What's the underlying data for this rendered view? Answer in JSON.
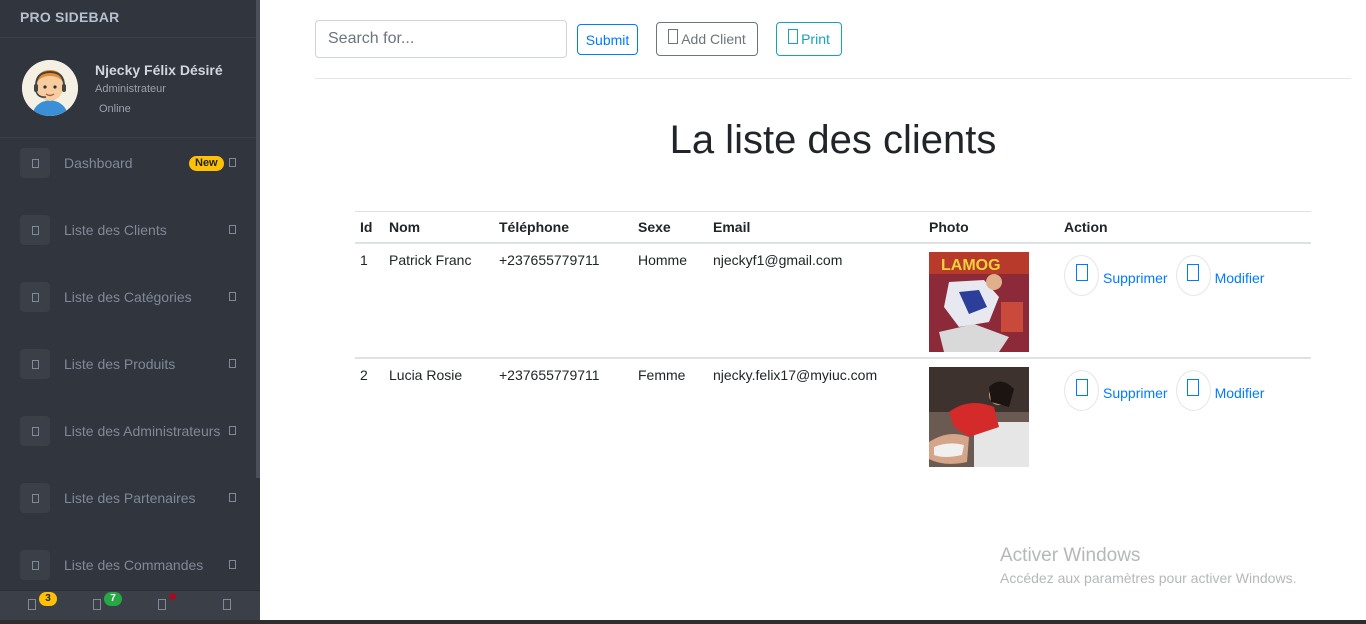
{
  "sidebar": {
    "brand": "PRO SIDEBAR",
    "user": {
      "name": "Njecky Félix Désiré",
      "role": "Administrateur",
      "status": "Online"
    },
    "items": [
      {
        "label": "Dashboard",
        "badge": "New"
      },
      {
        "label": "Liste des Clients"
      },
      {
        "label": "Liste des Catégories"
      },
      {
        "label": "Liste des Produits"
      },
      {
        "label": "Liste des Administrateurs"
      },
      {
        "label": "Liste des Partenaires"
      },
      {
        "label": "Liste des Commandes"
      }
    ],
    "footer": {
      "notifications_count": "3",
      "messages_count": "7"
    }
  },
  "toolbar": {
    "search_placeholder": "Search for...",
    "submit_label": "Submit",
    "add_client_label": "Add Client",
    "print_label": "Print"
  },
  "page": {
    "title": "La liste des clients"
  },
  "table": {
    "headers": [
      "Id",
      "Nom",
      "Téléphone",
      "Sexe",
      "Email",
      "Photo",
      "Action"
    ],
    "rows": [
      {
        "id": "1",
        "nom": "Patrick Franc",
        "telephone": "+237655779711",
        "sexe": "Homme",
        "email": "njeckyf1@gmail.com",
        "delete_label": "Supprimer",
        "edit_label": "Modifier"
      },
      {
        "id": "2",
        "nom": "Lucia Rosie",
        "telephone": "+237655779711",
        "sexe": "Femme",
        "email": "njecky.felix17@myiuc.com",
        "delete_label": "Supprimer",
        "edit_label": "Modifier"
      }
    ]
  },
  "watermark": {
    "title": "Activer Windows",
    "subtitle": "Accédez aux paramètres pour activer Windows."
  },
  "colors": {
    "sidebar_bg": "#31353d",
    "primary": "#007bff",
    "badge_new": "#ffc107",
    "badge_green": "#28a745",
    "info": "#17a2b8"
  }
}
